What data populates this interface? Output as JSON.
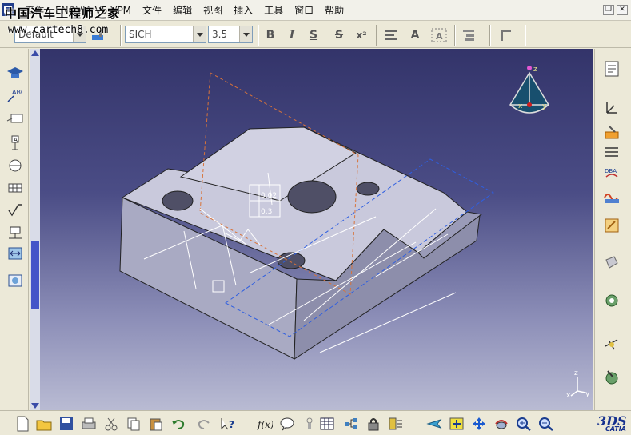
{
  "app": {
    "title_prefix": "工作",
    "title_mid": "ENOVIA V5 VPM"
  },
  "watermark": {
    "text": "中国汽车工程师之家",
    "url": "www.cartech8.com"
  },
  "menu": {
    "items": [
      {
        "label": "文件"
      },
      {
        "label": "编辑"
      },
      {
        "label": "视图"
      },
      {
        "label": "插入"
      },
      {
        "label": "工具"
      },
      {
        "label": "窗口"
      },
      {
        "label": "帮助"
      }
    ]
  },
  "toolbar": {
    "style_value": "Default",
    "font_value": "SICH",
    "size_value": "3.5",
    "bold_icon": "B",
    "italic_icon": "I",
    "underline_icon": "S",
    "strike_icon": "S",
    "superscript_icon": "x²",
    "text_color_icon": "A"
  },
  "gd_t": {
    "tolerance_1": "0.02",
    "tolerance_2": "0.3"
  },
  "axes": {
    "x": "x",
    "y": "y",
    "z": "z"
  },
  "colors": {
    "viewport_top": "#33346a",
    "viewport_bottom": "#b9bbd3",
    "part_top": "#c9c9dc",
    "part_front": "#a9aac3",
    "part_side": "#8d8eab",
    "plane_orange": "#d8733a",
    "plane_blue": "#2f5fe0",
    "scroll_thumb": "#4454c8"
  },
  "icons": {
    "left": [
      "drafting-hat-icon",
      "text-abc-icon",
      "balloon-icon",
      "datum-target-icon",
      "circle-icon",
      "grid-table-icon",
      "roughness-icon",
      "weld-icon",
      "dimension-icon",
      "view-frame-icon"
    ],
    "right": [
      "tree-icon",
      "axis-system-icon",
      "fill-icon",
      "constraint-icon",
      "dba-icon",
      "wave-icon",
      "sketch-icon",
      "visualization-icon",
      "gear-tools-icon",
      "measure-icon",
      "annotation-icon"
    ],
    "bottom": [
      "new-icon",
      "open-icon",
      "save-icon",
      "print-icon",
      "cut-icon",
      "copy-icon",
      "paste-icon",
      "undo-icon",
      "redo-icon",
      "whatsthis-icon",
      "formula-icon",
      "comment-icon",
      "table-icon",
      "tree-expand-icon",
      "lock-icon",
      "catalog-icon",
      "fly-icon",
      "fit-all-icon",
      "pan-icon",
      "rotate-icon",
      "zoom-in-icon",
      "zoom-out-icon"
    ]
  }
}
